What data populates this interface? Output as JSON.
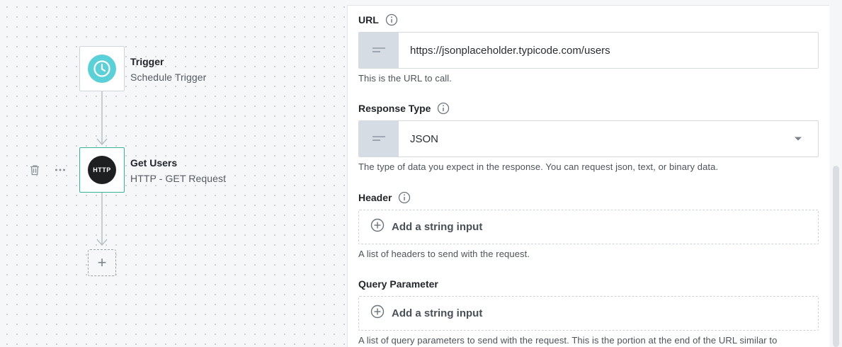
{
  "workflow": {
    "nodes": [
      {
        "title": "Trigger",
        "subtitle": "Schedule Trigger",
        "icon": "clock-icon"
      },
      {
        "title": "Get Users",
        "subtitle": "HTTP - GET Request",
        "icon_text": "HTTP"
      }
    ],
    "add_step_symbol": "+"
  },
  "panel": {
    "url": {
      "label": "URL",
      "value": "https://jsonplaceholder.typicode.com/users",
      "help": "This is the URL to call."
    },
    "response_type": {
      "label": "Response Type",
      "value": "JSON",
      "help": "The type of data you expect in the response. You can request json, text, or binary data."
    },
    "header": {
      "label": "Header",
      "add_label": "Add a string input",
      "help": "A list of headers to send with the request."
    },
    "query_parameter": {
      "label": "Query Parameter",
      "add_label": "Add a string input",
      "help": "A list of query parameters to send with the request. This is the portion at the end of the URL similar to"
    }
  },
  "colors": {
    "accent": "#35b398",
    "trigger_icon": "#5bd0d6",
    "http_icon": "#1d1f21"
  }
}
